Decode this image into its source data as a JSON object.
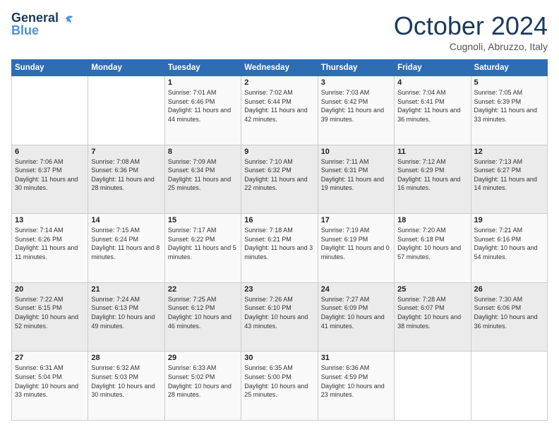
{
  "logo": {
    "line1": "General",
    "line2": "Blue"
  },
  "header": {
    "month": "October 2024",
    "location": "Cugnoli, Abruzzo, Italy"
  },
  "weekdays": [
    "Sunday",
    "Monday",
    "Tuesday",
    "Wednesday",
    "Thursday",
    "Friday",
    "Saturday"
  ],
  "weeks": [
    [
      {
        "day": "",
        "info": ""
      },
      {
        "day": "",
        "info": ""
      },
      {
        "day": "1",
        "info": "Sunrise: 7:01 AM\nSunset: 6:46 PM\nDaylight: 11 hours and 44 minutes."
      },
      {
        "day": "2",
        "info": "Sunrise: 7:02 AM\nSunset: 6:44 PM\nDaylight: 11 hours and 42 minutes."
      },
      {
        "day": "3",
        "info": "Sunrise: 7:03 AM\nSunset: 6:42 PM\nDaylight: 11 hours and 39 minutes."
      },
      {
        "day": "4",
        "info": "Sunrise: 7:04 AM\nSunset: 6:41 PM\nDaylight: 11 hours and 36 minutes."
      },
      {
        "day": "5",
        "info": "Sunrise: 7:05 AM\nSunset: 6:39 PM\nDaylight: 11 hours and 33 minutes."
      }
    ],
    [
      {
        "day": "6",
        "info": "Sunrise: 7:06 AM\nSunset: 6:37 PM\nDaylight: 11 hours and 30 minutes."
      },
      {
        "day": "7",
        "info": "Sunrise: 7:08 AM\nSunset: 6:36 PM\nDaylight: 11 hours and 28 minutes."
      },
      {
        "day": "8",
        "info": "Sunrise: 7:09 AM\nSunset: 6:34 PM\nDaylight: 11 hours and 25 minutes."
      },
      {
        "day": "9",
        "info": "Sunrise: 7:10 AM\nSunset: 6:32 PM\nDaylight: 11 hours and 22 minutes."
      },
      {
        "day": "10",
        "info": "Sunrise: 7:11 AM\nSunset: 6:31 PM\nDaylight: 11 hours and 19 minutes."
      },
      {
        "day": "11",
        "info": "Sunrise: 7:12 AM\nSunset: 6:29 PM\nDaylight: 11 hours and 16 minutes."
      },
      {
        "day": "12",
        "info": "Sunrise: 7:13 AM\nSunset: 6:27 PM\nDaylight: 11 hours and 14 minutes."
      }
    ],
    [
      {
        "day": "13",
        "info": "Sunrise: 7:14 AM\nSunset: 6:26 PM\nDaylight: 11 hours and 11 minutes."
      },
      {
        "day": "14",
        "info": "Sunrise: 7:15 AM\nSunset: 6:24 PM\nDaylight: 11 hours and 8 minutes."
      },
      {
        "day": "15",
        "info": "Sunrise: 7:17 AM\nSunset: 6:22 PM\nDaylight: 11 hours and 5 minutes."
      },
      {
        "day": "16",
        "info": "Sunrise: 7:18 AM\nSunset: 6:21 PM\nDaylight: 11 hours and 3 minutes."
      },
      {
        "day": "17",
        "info": "Sunrise: 7:19 AM\nSunset: 6:19 PM\nDaylight: 11 hours and 0 minutes."
      },
      {
        "day": "18",
        "info": "Sunrise: 7:20 AM\nSunset: 6:18 PM\nDaylight: 10 hours and 57 minutes."
      },
      {
        "day": "19",
        "info": "Sunrise: 7:21 AM\nSunset: 6:16 PM\nDaylight: 10 hours and 54 minutes."
      }
    ],
    [
      {
        "day": "20",
        "info": "Sunrise: 7:22 AM\nSunset: 6:15 PM\nDaylight: 10 hours and 52 minutes."
      },
      {
        "day": "21",
        "info": "Sunrise: 7:24 AM\nSunset: 6:13 PM\nDaylight: 10 hours and 49 minutes."
      },
      {
        "day": "22",
        "info": "Sunrise: 7:25 AM\nSunset: 6:12 PM\nDaylight: 10 hours and 46 minutes."
      },
      {
        "day": "23",
        "info": "Sunrise: 7:26 AM\nSunset: 6:10 PM\nDaylight: 10 hours and 43 minutes."
      },
      {
        "day": "24",
        "info": "Sunrise: 7:27 AM\nSunset: 6:09 PM\nDaylight: 10 hours and 41 minutes."
      },
      {
        "day": "25",
        "info": "Sunrise: 7:28 AM\nSunset: 6:07 PM\nDaylight: 10 hours and 38 minutes."
      },
      {
        "day": "26",
        "info": "Sunrise: 7:30 AM\nSunset: 6:06 PM\nDaylight: 10 hours and 36 minutes."
      }
    ],
    [
      {
        "day": "27",
        "info": "Sunrise: 6:31 AM\nSunset: 5:04 PM\nDaylight: 10 hours and 33 minutes."
      },
      {
        "day": "28",
        "info": "Sunrise: 6:32 AM\nSunset: 5:03 PM\nDaylight: 10 hours and 30 minutes."
      },
      {
        "day": "29",
        "info": "Sunrise: 6:33 AM\nSunset: 5:02 PM\nDaylight: 10 hours and 28 minutes."
      },
      {
        "day": "30",
        "info": "Sunrise: 6:35 AM\nSunset: 5:00 PM\nDaylight: 10 hours and 25 minutes."
      },
      {
        "day": "31",
        "info": "Sunrise: 6:36 AM\nSunset: 4:59 PM\nDaylight: 10 hours and 23 minutes."
      },
      {
        "day": "",
        "info": ""
      },
      {
        "day": "",
        "info": ""
      }
    ]
  ]
}
